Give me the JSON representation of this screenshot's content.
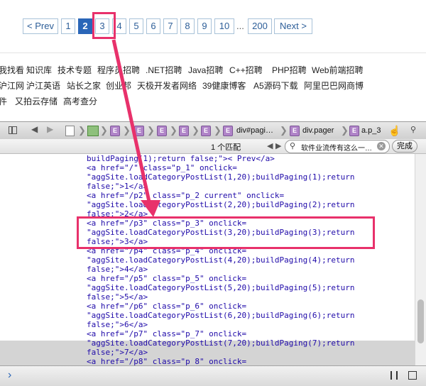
{
  "pager": {
    "prev": "< Prev",
    "pages": [
      "1",
      "2",
      "3",
      "4",
      "5",
      "6",
      "7",
      "8",
      "9",
      "10"
    ],
    "dots": "...",
    "last": "200",
    "next": "Next >"
  },
  "links": {
    "row1": [
      "我找看",
      "知识库",
      "技术专题",
      "程序员招聘",
      ".NET招聘",
      "Java招聘",
      "C++招聘",
      "PHP招聘",
      "Web前端招聘"
    ],
    "row2": [
      "沪江网",
      "沪江英语",
      "站长之家",
      "创业邦",
      "天极开发者网络",
      "39健康博客",
      "A5源码下载",
      "阿里巴巴网商博"
    ],
    "row3": [
      "件",
      "又拍云存储",
      "高考查分"
    ]
  },
  "devtools": {
    "breadcrumbs": [
      "div#pagi…",
      "div.pager",
      "a.p_3"
    ],
    "match_count": "1 个匹配",
    "search_value": "软件业流传有这么一…",
    "done_label": "完成",
    "console_prompt": "›"
  },
  "code_lines": [
    "buildPaging(1);return false;\">< Prev</a>",
    "<a href=\"/\" class=\"p_1\" onclick=",
    "\"aggSite.loadCategoryPostList(1,20);buildPaging(1);return",
    "false;\">1</a>",
    "<a href=\"/p2\" class=\"p_2 current\" onclick=",
    "\"aggSite.loadCategoryPostList(2,20);buildPaging(2);return",
    "false;\">2</a>",
    "<a href=\"/p3\" class=\"p_3\" onclick=",
    "\"aggSite.loadCategoryPostList(3,20);buildPaging(3);return",
    "false;\">3</a>",
    "<a href=\"/p4\" class=\"p_4\" onclick=",
    "\"aggSite.loadCategoryPostList(4,20);buildPaging(4);return",
    "false;\">4</a>",
    "<a href=\"/p5\" class=\"p_5\" onclick=",
    "\"aggSite.loadCategoryPostList(5,20);buildPaging(5);return",
    "false;\">5</a>",
    "<a href=\"/p6\" class=\"p_6\" onclick=",
    "\"aggSite.loadCategoryPostList(6,20);buildPaging(6);return",
    "false;\">6</a>",
    "<a href=\"/p7\" class=\"p_7\" onclick=",
    "\"aggSite.loadCategoryPostList(7,20);buildPaging(7);return",
    "false;\">7</a>",
    "<a href=\"/p8\" class=\"p_8\" onclick="
  ],
  "colors": {
    "accent": "#e8316b",
    "link": "#2d5e98",
    "current_page": "#2a66b8"
  }
}
